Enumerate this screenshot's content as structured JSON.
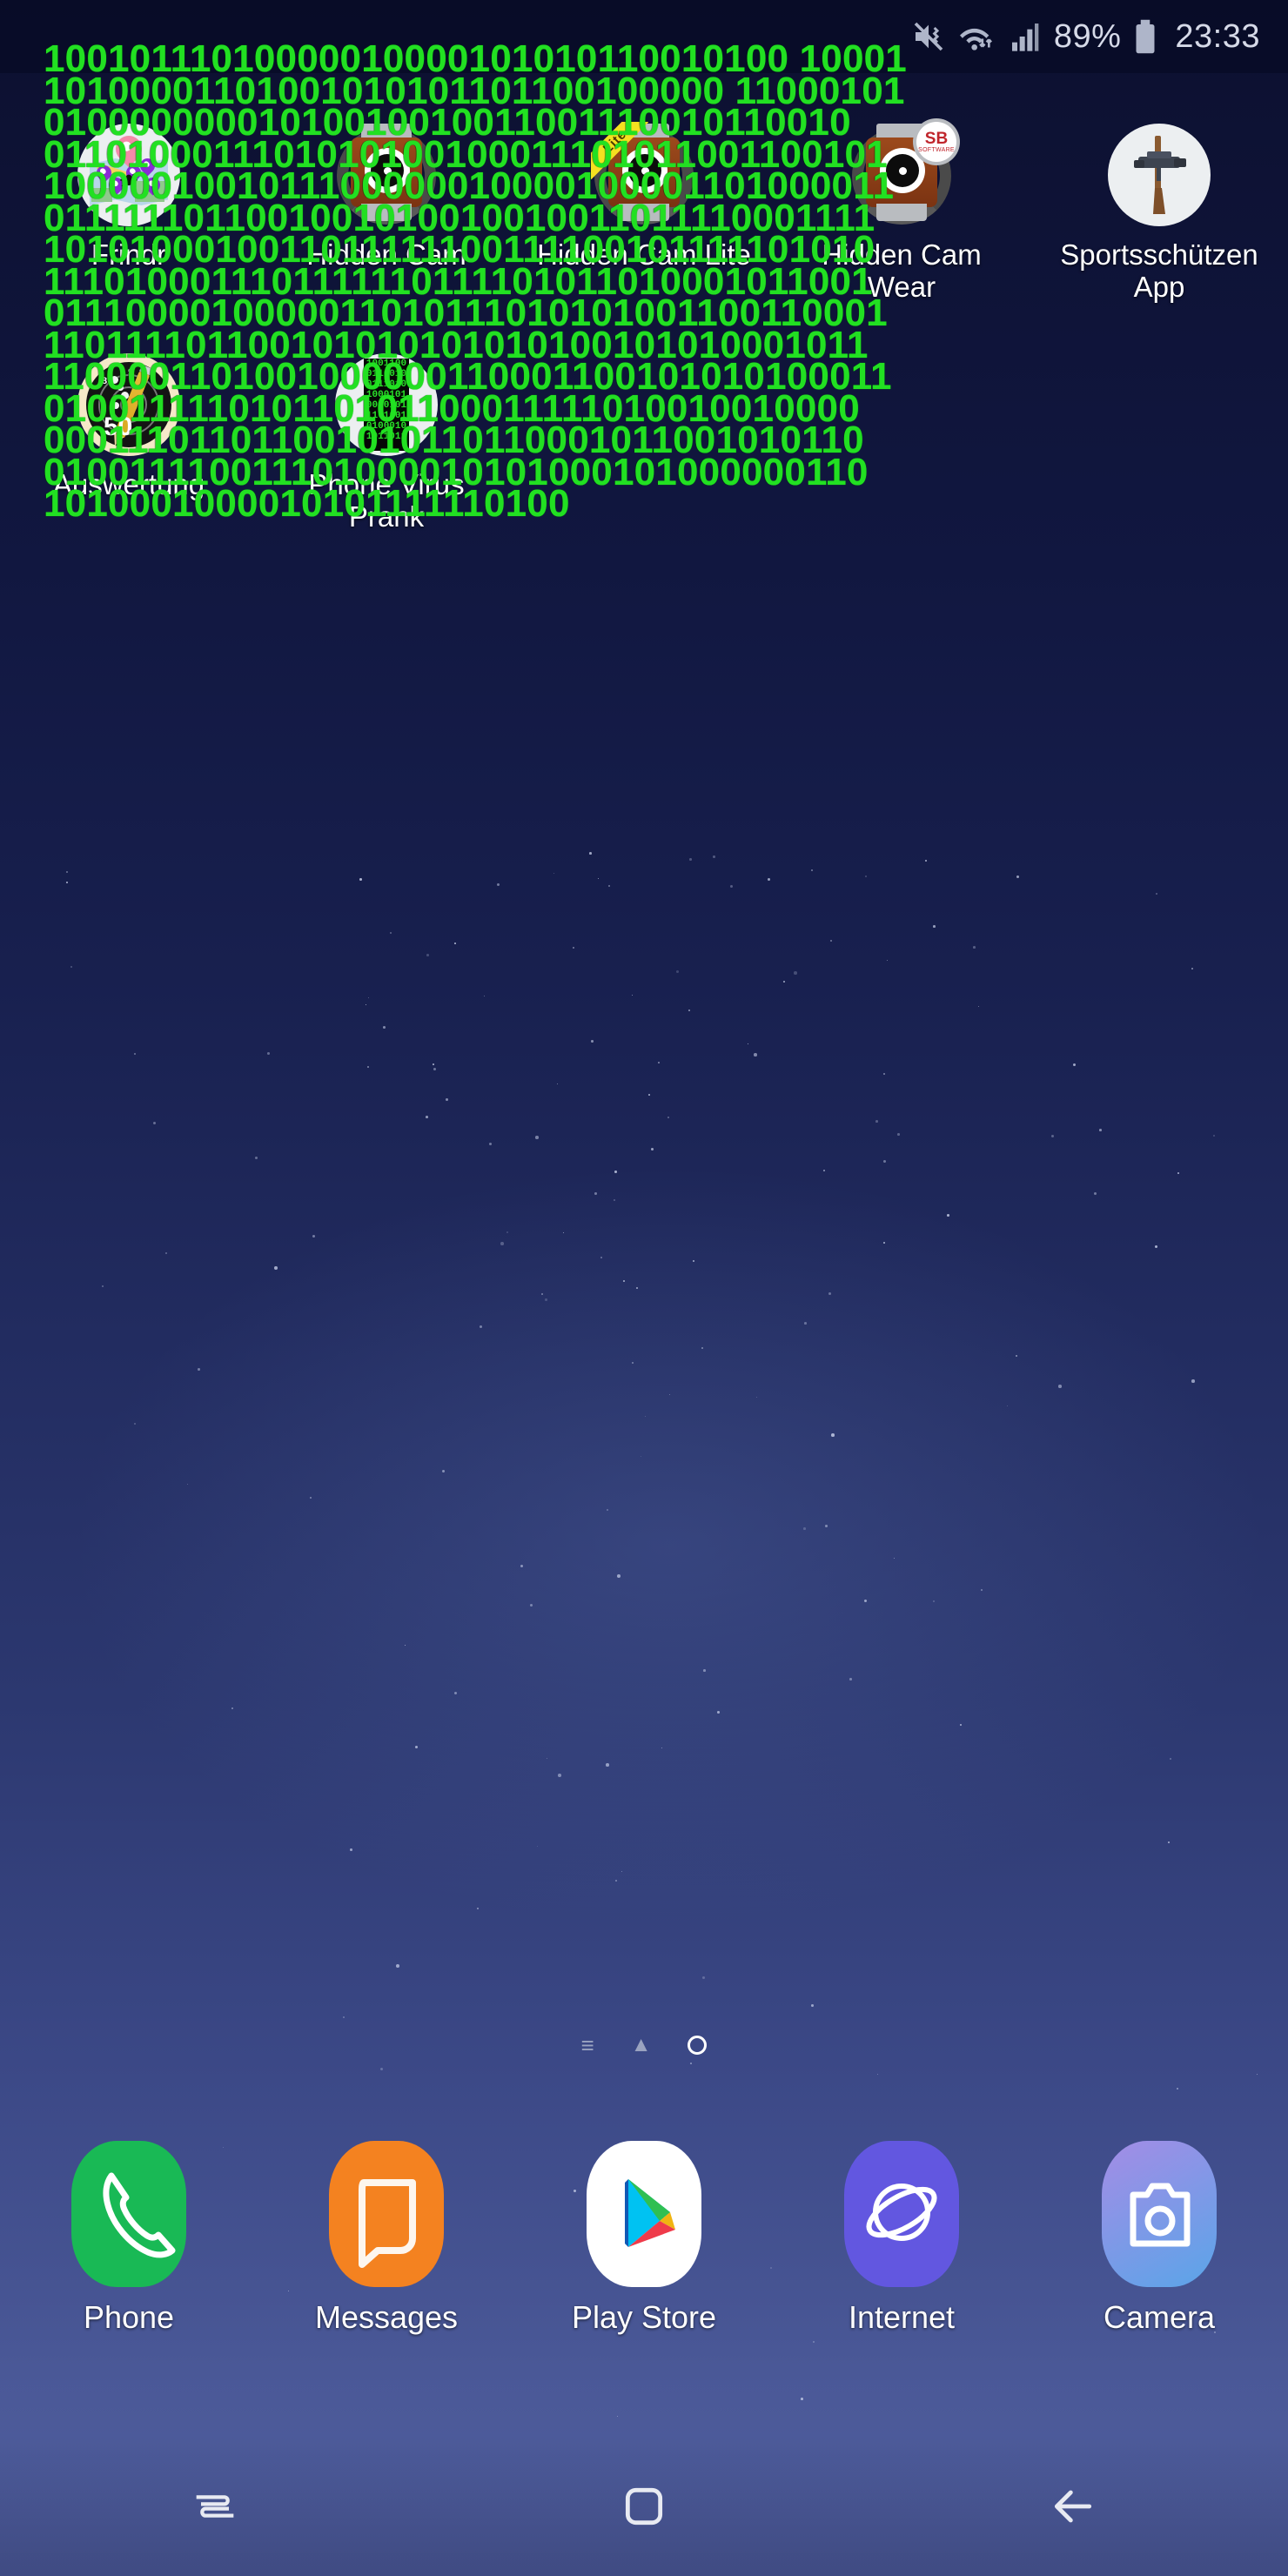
{
  "status_bar": {
    "mute_icon": "mute-vibrate-icon",
    "wifi_icon": "wifi-icon",
    "signal_icon": "signal-bars-icon",
    "battery_percent": "89%",
    "battery_icon": "battery-icon",
    "clock": "23:33"
  },
  "wallpaper": {
    "type": "binary-code-overlay",
    "text_color": "#22e022",
    "background_color": "#0d1033",
    "binary_lines": [
      "1001011101000001000010101011001010010001",
      "1010000110100101010110110010000011000101",
      "0100000000101001001001100111001011001 0",
      "0110100011101010100100011101011001100101",
      "1000001001011100000010000100001101000011",
      "0111111011001001010010010011011110001111",
      "1010100010011011111100111100101111101010",
      "1110100011101111110111101011010001011001",
      "0111000010000011010111010101001100110001",
      "1101111011001010101010101001010100010 11",
      "1100001101001000000110001100101010100011",
      "0100111110101101011000111110100100100 00",
      "0001110110110010101101100010110010101 10",
      "0100111100111010000101010001010000001 10",
      "1010001000010101111110100"
    ],
    "visual_binary_rows": [
      "10010111010000010000101010110010100 10001",
      "10100001101001010101101100100000 11000101",
      "01000000001010010010011001110010110010",
      "0110100011101010100100011101011001100101",
      "1000001001011100000010000100001101000011",
      "0111111011001001010010010011011110001111",
      "1010100010011011111100111100101111101010",
      "1110100011101111110111101011010001011001",
      "0111000010000011010111010101001100110001",
      "110111101100101010101010100101010001011",
      "1100001101001000000110001100101010100011",
      "010011111010110101100011111010010010000",
      "000111011011001010110110001011001010110",
      "010011110011101000010101000101000000110",
      "1010001000010101111110100"
    ]
  },
  "app_grid": {
    "rows": [
      [
        {
          "label": "Frindr",
          "icon": "map-pin-icon"
        },
        {
          "label": "Hidden Cam",
          "icon": "retro-camera-icon"
        },
        {
          "label": "Hidden Cam Lite",
          "icon": "retro-camera-lite-icon",
          "badge": "Lite"
        },
        {
          "label": "Hidden Cam Wear",
          "icon": "retro-camera-wear-icon",
          "badge_brand": "SB",
          "badge_sub": "SOFTWARE"
        },
        {
          "label": "Sportsschützen App",
          "icon": "rifle-icon"
        }
      ],
      [
        {
          "label": "Auswertung",
          "icon": "shooting-target-icon",
          "score": "50"
        },
        {
          "label": "Phone Virus Prank",
          "icon": "phone-virus-icon"
        }
      ]
    ]
  },
  "page_indicator": {
    "items": [
      "list-glyph",
      "home-glyph",
      "current-page-dot"
    ],
    "current_page": 3
  },
  "dock": {
    "items": [
      {
        "label": "Phone",
        "icon": "phone-icon",
        "color": "#19b955"
      },
      {
        "label": "Messages",
        "icon": "message-bubble-icon",
        "color": "#f48220"
      },
      {
        "label": "Play Store",
        "icon": "play-store-icon",
        "color": "#ffffff"
      },
      {
        "label": "Internet",
        "icon": "internet-planet-icon",
        "color": "#6257e0"
      },
      {
        "label": "Camera",
        "icon": "camera-icon",
        "color": "#7f8fe8"
      }
    ]
  },
  "nav_bar": {
    "items": [
      {
        "name": "recents-button",
        "glyph": "recents-icon"
      },
      {
        "name": "home-button",
        "glyph": "home-square-icon"
      },
      {
        "name": "back-button",
        "glyph": "back-arrow-icon"
      }
    ]
  }
}
